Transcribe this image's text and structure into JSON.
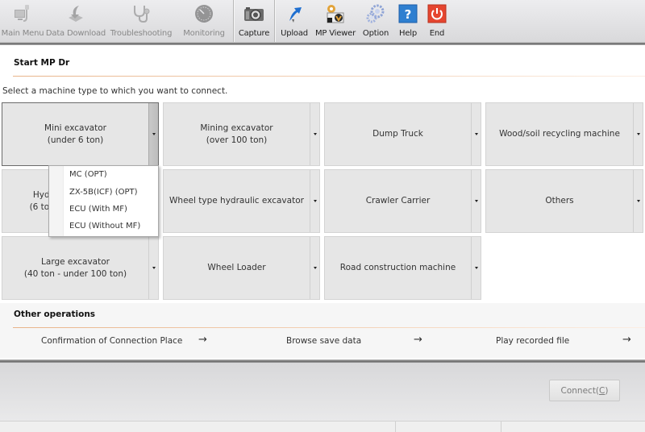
{
  "toolbar": {
    "items": [
      {
        "label": "Main Menu",
        "icon": "computer-icon",
        "enabled": false
      },
      {
        "label": "Data Download",
        "icon": "download-icon",
        "enabled": false
      },
      {
        "label": "Troubleshooting",
        "icon": "stethoscope-icon",
        "enabled": false
      },
      {
        "label": "Monitoring",
        "icon": "gauge-icon",
        "enabled": false
      },
      {
        "label": "Capture",
        "icon": "camera-icon",
        "enabled": true
      },
      {
        "label": "Upload",
        "icon": "upload-arrow-icon",
        "enabled": true
      },
      {
        "label": "MP Viewer",
        "icon": "mp-viewer-icon",
        "enabled": true
      },
      {
        "label": "Option",
        "icon": "gears-icon",
        "enabled": true
      },
      {
        "label": "Help",
        "icon": "help-icon",
        "enabled": true
      },
      {
        "label": "End",
        "icon": "power-icon",
        "enabled": true
      }
    ]
  },
  "start_section": {
    "title": "Start MP Dr",
    "instruction": "Select a machine type to which you want to connect."
  },
  "machines": [
    {
      "label": "Mini excavator\n(under 6 ton)",
      "selected": true
    },
    {
      "label": "Mining excavator\n(over 100 ton)",
      "selected": false
    },
    {
      "label": "Dump Truck",
      "selected": false
    },
    {
      "label": "Wood/soil recycling machine",
      "selected": false
    },
    {
      "label": "Hydraulic excavator\n(6 ton - under 40 ton)",
      "selected": false
    },
    {
      "label": "Wheel type hydraulic excavator",
      "selected": false
    },
    {
      "label": "Crawler Carrier",
      "selected": false
    },
    {
      "label": "Others",
      "selected": false
    },
    {
      "label": "Large excavator\n(40 ton - under 100 ton)",
      "selected": false
    },
    {
      "label": "Wheel Loader",
      "selected": false
    },
    {
      "label": "Road construction machine",
      "selected": false
    }
  ],
  "dropdown": {
    "items": [
      "MC (OPT)",
      "ZX-5B(ICF) (OPT)",
      "ECU (With MF)",
      "ECU (Without MF)"
    ]
  },
  "other_operations": {
    "title": "Other operations",
    "items": [
      {
        "label": "Confirmation of Connection Place",
        "arrow": "→"
      },
      {
        "label": "Browse save data",
        "arrow": "→"
      },
      {
        "label": "Play recorded file",
        "arrow": "→"
      }
    ]
  },
  "footer": {
    "connect_label": "Connect(",
    "connect_mnemonic": "C",
    "connect_suffix": ")",
    "connect_enabled": false
  },
  "colors": {
    "accent_rule": "#e8b48a",
    "tile_bg": "#e6e6e6",
    "help_blue": "#2f7fd0",
    "end_red": "#e5452f"
  }
}
